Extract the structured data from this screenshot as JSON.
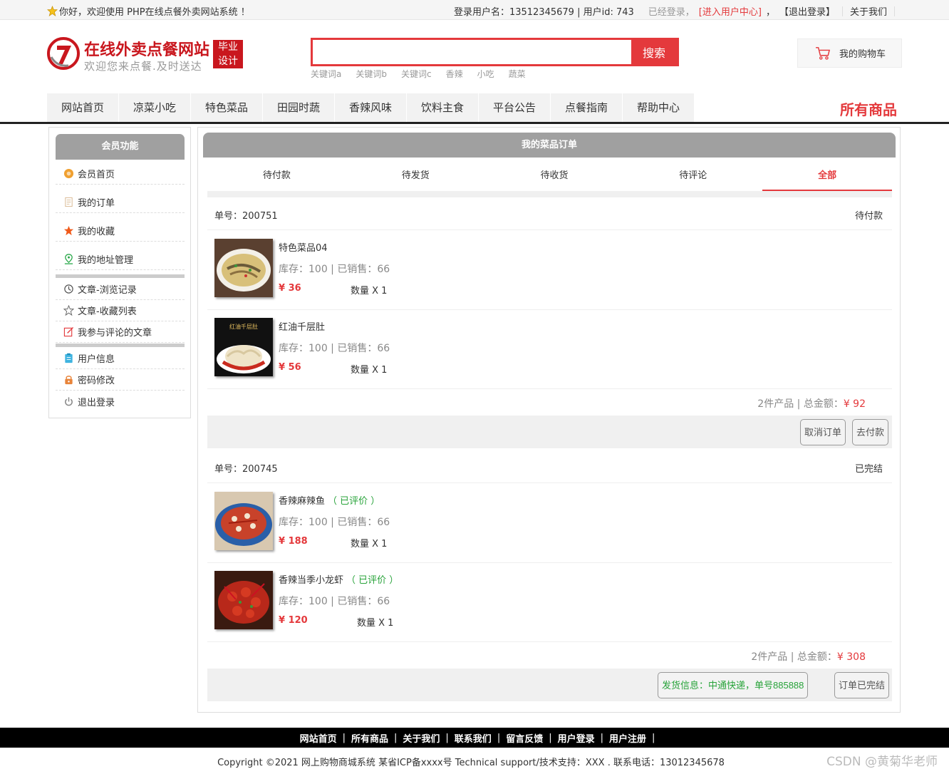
{
  "topbar": {
    "welcome": "你好，欢迎使用 PHP在线点餐外卖网站系统 ！",
    "user_info": "登录用户名：13512345679 | 用户id: 743",
    "logged_in": "已经登录，",
    "user_center": "[进入用户中心]",
    "comma": "，",
    "logout": "【退出登录】",
    "about": "关于我们"
  },
  "logo": {
    "title": "在线外卖点餐网站",
    "subtitle": "欢迎您来点餐.及时送达",
    "badge_line1": "毕业",
    "badge_line2": "设计"
  },
  "search": {
    "value": "",
    "button_label": "搜索",
    "keywords": [
      "关键词a",
      "关键词b",
      "关键词c",
      "香辣",
      "小吃",
      "蔬菜"
    ]
  },
  "cart": {
    "label": "我的购物车"
  },
  "nav": {
    "items": [
      "网站首页",
      "凉菜小吃",
      "特色菜品",
      "田园时蔬",
      "香辣风味",
      "饮料主食",
      "平台公告",
      "点餐指南",
      "帮助中心"
    ],
    "all_products": "所有商品"
  },
  "sidebar": {
    "title": "会员功能",
    "items": [
      {
        "label": "会员首页",
        "icon": "home-icon"
      },
      {
        "label": "我的订单",
        "icon": "order-icon"
      },
      {
        "label": "我的收藏",
        "icon": "star-icon"
      },
      {
        "label": "我的地址管理",
        "icon": "location-icon"
      },
      {
        "label": "文章-浏览记录",
        "icon": "history-icon"
      },
      {
        "label": "文章-收藏列表",
        "icon": "star-outline-icon"
      },
      {
        "label": "我参与评论的文章",
        "icon": "edit-icon"
      },
      {
        "label": "用户信息",
        "icon": "clipboard-icon"
      },
      {
        "label": "密码修改",
        "icon": "lock-icon"
      },
      {
        "label": "退出登录",
        "icon": "power-icon"
      }
    ]
  },
  "main": {
    "title": "我的菜品订单",
    "tabs": [
      "待付款",
      "待发货",
      "待收货",
      "待评论",
      "全部"
    ],
    "active_tab": "全部",
    "orders": [
      {
        "number": "单号：200751",
        "status": "待付款",
        "items": [
          {
            "name": "特色菜品04",
            "reviewed": "",
            "stock": "库存：100 | 已销售：66",
            "price": "¥ 36",
            "qty": "数量 X 1"
          },
          {
            "name": "红油千层肚",
            "reviewed": "",
            "stock": "库存：100 | 已销售：66",
            "price": "¥ 56",
            "qty": "数量 X 1"
          }
        ],
        "summary": "2件产品 | 总金额：",
        "total": "¥ 92",
        "buttons": [
          "取消订单",
          "去付款"
        ]
      },
      {
        "number": "单号：200745",
        "status": "已完结",
        "items": [
          {
            "name": "香辣麻辣鱼",
            "reviewed": "（ 已评价 ）",
            "stock": "库存：100 | 已销售：66",
            "price": "¥ 188",
            "qty": "数量 X 1"
          },
          {
            "name": "香辣当季小龙虾",
            "reviewed": "（ 已评价 ）",
            "stock": "库存：100 | 已销售：66",
            "price": "¥ 120",
            "qty": "数量 X 1"
          }
        ],
        "summary": "2件产品 | 总金额：",
        "total": "¥ 308",
        "buttons": [
          "发货信息：中通快递，单号885888",
          "订单已完结"
        ]
      }
    ],
    "thumb_text": "红油千层肚"
  },
  "footer": {
    "links": [
      "网站首页",
      "所有商品",
      "关于我们",
      "联系我们",
      "留言反馈",
      "用户登录",
      "用户注册"
    ],
    "separator": "|",
    "copyright": "Copyright ©2021 网上购物商城系统 某省ICP备xxxx号 Technical support/技术支持：XXX . 联系电话：13012345678",
    "watermark": "CSDN @黄菊华老师"
  },
  "colors": {
    "accent": "#e4393c",
    "brand": "#c9171e",
    "header_gray": "#a0a0a0",
    "reviewed_green": "#28a33a"
  }
}
